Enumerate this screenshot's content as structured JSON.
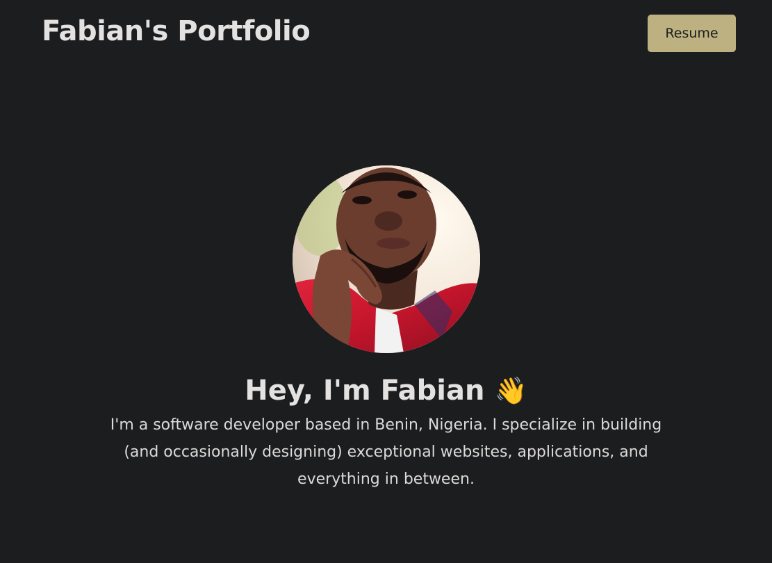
{
  "header": {
    "title": "Fabian's Portfolio",
    "resume_label": "Resume"
  },
  "hero": {
    "avatar_alt": "Fabian profile photo",
    "greeting": "Hey, I'm Fabian",
    "wave_emoji": "👋",
    "bio": "I'm a software developer based in Benin, Nigeria. I specialize in building (and occasionally designing) exceptional websites, applications, and everything in between."
  },
  "colors": {
    "background": "#1c1d1f",
    "accent": "#bdb181",
    "text": "#e4e2e1"
  },
  "icons": {
    "wave": "waving-hand-icon"
  }
}
